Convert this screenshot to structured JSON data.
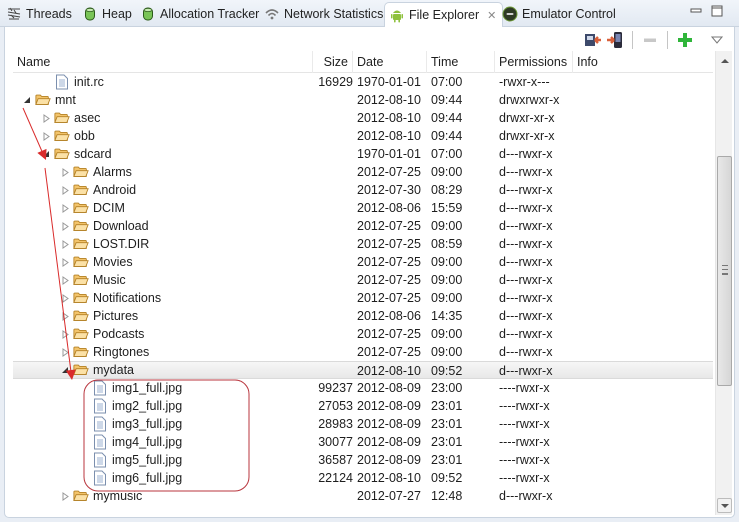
{
  "tabs": [
    {
      "label": "Threads",
      "icon": "threads-icon",
      "active": false
    },
    {
      "label": "Heap",
      "icon": "heap-icon",
      "active": false
    },
    {
      "label": "Allocation Tracker",
      "icon": "allocation-tracker-icon",
      "active": false
    },
    {
      "label": "Network Statistics",
      "icon": "network-statistics-icon",
      "active": false
    },
    {
      "label": "File Explorer",
      "icon": "android-icon",
      "active": true,
      "close": "✕"
    },
    {
      "label": "Emulator Control",
      "icon": "emulator-control-icon",
      "active": false
    }
  ],
  "window_controls": {
    "minimize": "minimize-icon",
    "maximize": "maximize-icon"
  },
  "toolbar": {
    "items": [
      {
        "name": "pull-file-button",
        "icon": "pull-file-icon"
      },
      {
        "name": "push-file-button",
        "icon": "push-file-icon"
      },
      {
        "name": "delete-button",
        "icon": "minus-icon"
      },
      {
        "name": "new-folder-button",
        "icon": "plus-icon"
      },
      {
        "name": "view-menu-button",
        "icon": "chevron-down-icon"
      }
    ]
  },
  "table": {
    "columns": [
      "Name",
      "Size",
      "Date",
      "Time",
      "Permissions",
      "Info"
    ],
    "rows": [
      {
        "name": "init.rc",
        "type": "file",
        "depth": 1,
        "twisty": "none",
        "size": "16929",
        "date": "1970-01-01",
        "time": "07:00",
        "perm": "-rwxr-x---"
      },
      {
        "name": "mnt",
        "type": "folder",
        "depth": 0,
        "twisty": "open",
        "size": "",
        "date": "2012-08-10",
        "time": "09:44",
        "perm": "drwxrwxr-x"
      },
      {
        "name": "asec",
        "type": "folder",
        "depth": 1,
        "twisty": "closed",
        "size": "",
        "date": "2012-08-10",
        "time": "09:44",
        "perm": "drwxr-xr-x"
      },
      {
        "name": "obb",
        "type": "folder",
        "depth": 1,
        "twisty": "closed",
        "size": "",
        "date": "2012-08-10",
        "time": "09:44",
        "perm": "drwxr-xr-x"
      },
      {
        "name": "sdcard",
        "type": "folder",
        "depth": 1,
        "twisty": "open",
        "size": "",
        "date": "1970-01-01",
        "time": "07:00",
        "perm": "d---rwxr-x"
      },
      {
        "name": "Alarms",
        "type": "folder",
        "depth": 2,
        "twisty": "closed",
        "size": "",
        "date": "2012-07-25",
        "time": "09:00",
        "perm": "d---rwxr-x"
      },
      {
        "name": "Android",
        "type": "folder",
        "depth": 2,
        "twisty": "closed",
        "size": "",
        "date": "2012-07-30",
        "time": "08:29",
        "perm": "d---rwxr-x"
      },
      {
        "name": "DCIM",
        "type": "folder",
        "depth": 2,
        "twisty": "closed",
        "size": "",
        "date": "2012-08-06",
        "time": "15:59",
        "perm": "d---rwxr-x"
      },
      {
        "name": "Download",
        "type": "folder",
        "depth": 2,
        "twisty": "closed",
        "size": "",
        "date": "2012-07-25",
        "time": "09:00",
        "perm": "d---rwxr-x"
      },
      {
        "name": "LOST.DIR",
        "type": "folder",
        "depth": 2,
        "twisty": "closed",
        "size": "",
        "date": "2012-07-25",
        "time": "08:59",
        "perm": "d---rwxr-x"
      },
      {
        "name": "Movies",
        "type": "folder",
        "depth": 2,
        "twisty": "closed",
        "size": "",
        "date": "2012-07-25",
        "time": "09:00",
        "perm": "d---rwxr-x"
      },
      {
        "name": "Music",
        "type": "folder",
        "depth": 2,
        "twisty": "closed",
        "size": "",
        "date": "2012-07-25",
        "time": "09:00",
        "perm": "d---rwxr-x"
      },
      {
        "name": "Notifications",
        "type": "folder",
        "depth": 2,
        "twisty": "closed",
        "size": "",
        "date": "2012-07-25",
        "time": "09:00",
        "perm": "d---rwxr-x"
      },
      {
        "name": "Pictures",
        "type": "folder",
        "depth": 2,
        "twisty": "closed",
        "size": "",
        "date": "2012-08-06",
        "time": "14:35",
        "perm": "d---rwxr-x"
      },
      {
        "name": "Podcasts",
        "type": "folder",
        "depth": 2,
        "twisty": "closed",
        "size": "",
        "date": "2012-07-25",
        "time": "09:00",
        "perm": "d---rwxr-x"
      },
      {
        "name": "Ringtones",
        "type": "folder",
        "depth": 2,
        "twisty": "closed",
        "size": "",
        "date": "2012-07-25",
        "time": "09:00",
        "perm": "d---rwxr-x"
      },
      {
        "name": "mydata",
        "type": "folder",
        "depth": 2,
        "twisty": "open",
        "size": "",
        "date": "2012-08-10",
        "time": "09:52",
        "perm": "d---rwxr-x",
        "selected": true
      },
      {
        "name": "img1_full.jpg",
        "type": "file",
        "depth": 3,
        "twisty": "none",
        "size": "99237",
        "date": "2012-08-09",
        "time": "23:00",
        "perm": "----rwxr-x"
      },
      {
        "name": "img2_full.jpg",
        "type": "file",
        "depth": 3,
        "twisty": "none",
        "size": "27053",
        "date": "2012-08-09",
        "time": "23:01",
        "perm": "----rwxr-x"
      },
      {
        "name": "img3_full.jpg",
        "type": "file",
        "depth": 3,
        "twisty": "none",
        "size": "28983",
        "date": "2012-08-09",
        "time": "23:01",
        "perm": "----rwxr-x"
      },
      {
        "name": "img4_full.jpg",
        "type": "file",
        "depth": 3,
        "twisty": "none",
        "size": "30077",
        "date": "2012-08-09",
        "time": "23:01",
        "perm": "----rwxr-x"
      },
      {
        "name": "img5_full.jpg",
        "type": "file",
        "depth": 3,
        "twisty": "none",
        "size": "36587",
        "date": "2012-08-09",
        "time": "23:01",
        "perm": "----rwxr-x"
      },
      {
        "name": "img6_full.jpg",
        "type": "file",
        "depth": 3,
        "twisty": "none",
        "size": "22124",
        "date": "2012-08-10",
        "time": "09:52",
        "perm": "----rwxr-x"
      },
      {
        "name": "mymusic",
        "type": "folder",
        "depth": 2,
        "twisty": "closed",
        "size": "",
        "date": "2012-07-27",
        "time": "12:48",
        "perm": "d---rwxr-x"
      }
    ]
  },
  "scrollbar": {
    "position": 0.32,
    "visible_fraction": 0.55
  },
  "annotation_color": "#d92b2b"
}
